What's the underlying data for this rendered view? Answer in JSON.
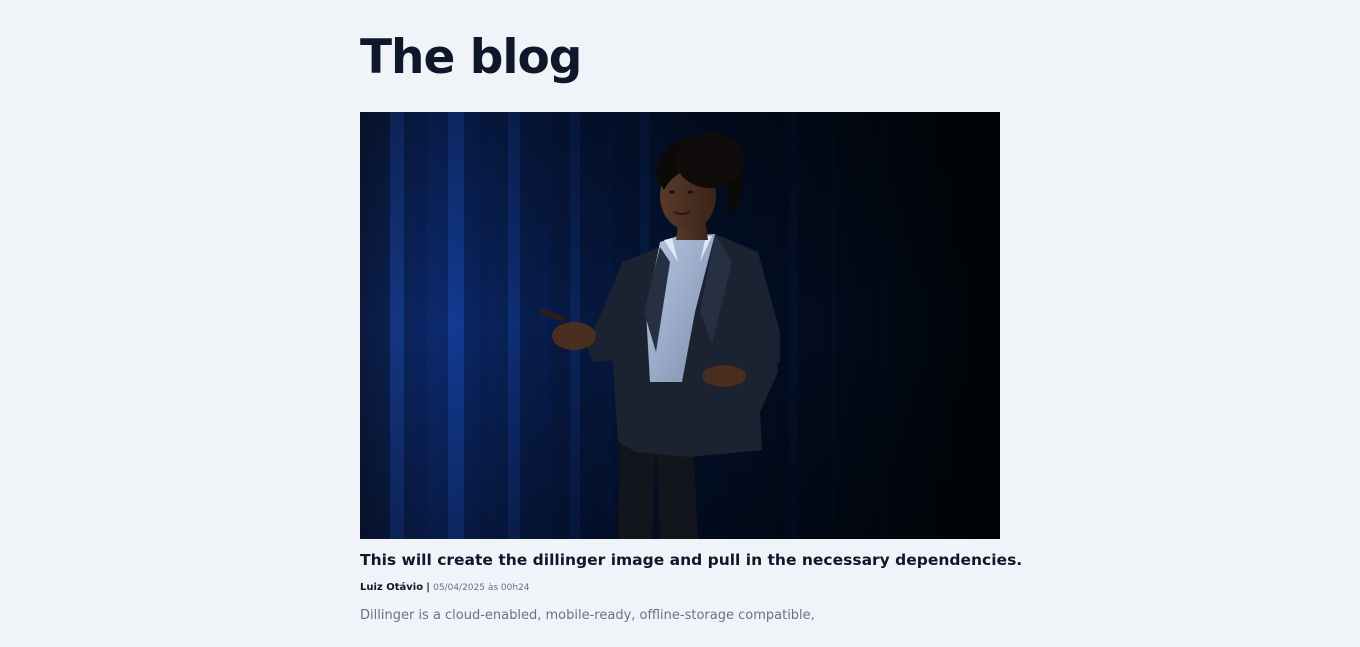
{
  "page": {
    "title": "The blog"
  },
  "post": {
    "image_subject": "woman-presenter-on-stage-photo",
    "title": "This will create the dillinger image and pull in the necessary dependencies.",
    "author": "Luiz Otávio",
    "separator": "|",
    "date": "05/04/2025 às 00h24",
    "excerpt": "Dillinger is a cloud-enabled, mobile-ready, offline-storage compatible,"
  },
  "colors": {
    "background": "#f0f4f9",
    "heading": "#0f172a",
    "muted": "#64748b"
  }
}
